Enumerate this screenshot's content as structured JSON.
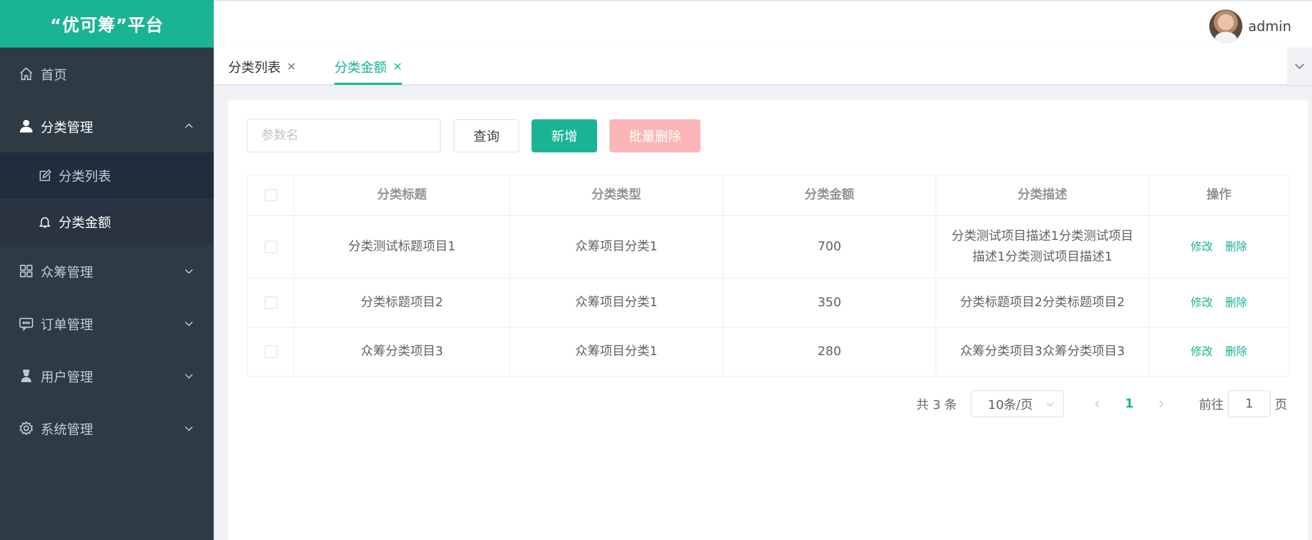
{
  "app": {
    "title": "“优可筹”平台"
  },
  "sidebar": {
    "items": [
      {
        "label": "首页",
        "icon": "home-icon"
      },
      {
        "label": "分类管理",
        "icon": "user-icon",
        "expanded": true,
        "children": [
          {
            "label": "分类列表",
            "icon": "edit-icon"
          },
          {
            "label": "分类金额",
            "icon": "bell-icon",
            "active": true
          }
        ]
      },
      {
        "label": "众筹管理",
        "icon": "grid-icon"
      },
      {
        "label": "订单管理",
        "icon": "chat-icon"
      },
      {
        "label": "用户管理",
        "icon": "person-icon"
      },
      {
        "label": "系统管理",
        "icon": "gear-icon"
      }
    ]
  },
  "header": {
    "username": "admin"
  },
  "tabs": [
    {
      "label": "分类列表",
      "active": false
    },
    {
      "label": "分类金额",
      "active": true
    }
  ],
  "toolbar": {
    "search_placeholder": "参数名",
    "search_value": "",
    "query_label": "查询",
    "add_label": "新增",
    "batch_delete_label": "批量删除"
  },
  "table": {
    "headers": [
      "分类标题",
      "分类类型",
      "分类金额",
      "分类描述",
      "操作"
    ],
    "rows": [
      {
        "title": "分类测试标题项目1",
        "type": "众筹项目分类1",
        "amount": "700",
        "desc": "分类测试项目描述1分类测试项目描述1分类测试项目描述1"
      },
      {
        "title": "分类标题项目2",
        "type": "众筹项目分类1",
        "amount": "350",
        "desc": "分类标题项目2分类标题项目2"
      },
      {
        "title": "众筹分类项目3",
        "type": "众筹项目分类1",
        "amount": "280",
        "desc": "众筹分类项目3众筹分类项目3"
      }
    ],
    "edit_label": "修改",
    "delete_label": "删除"
  },
  "pagination": {
    "total_text": "共 3 条",
    "page_size": "10条/页",
    "current_page": "1",
    "jump_label": "前往",
    "jump_value": "1",
    "jump_unit": "页"
  },
  "colors": {
    "primary": "#1ab394",
    "sidebar_bg": "#2f3b44",
    "danger_light": "#fab6b6"
  }
}
